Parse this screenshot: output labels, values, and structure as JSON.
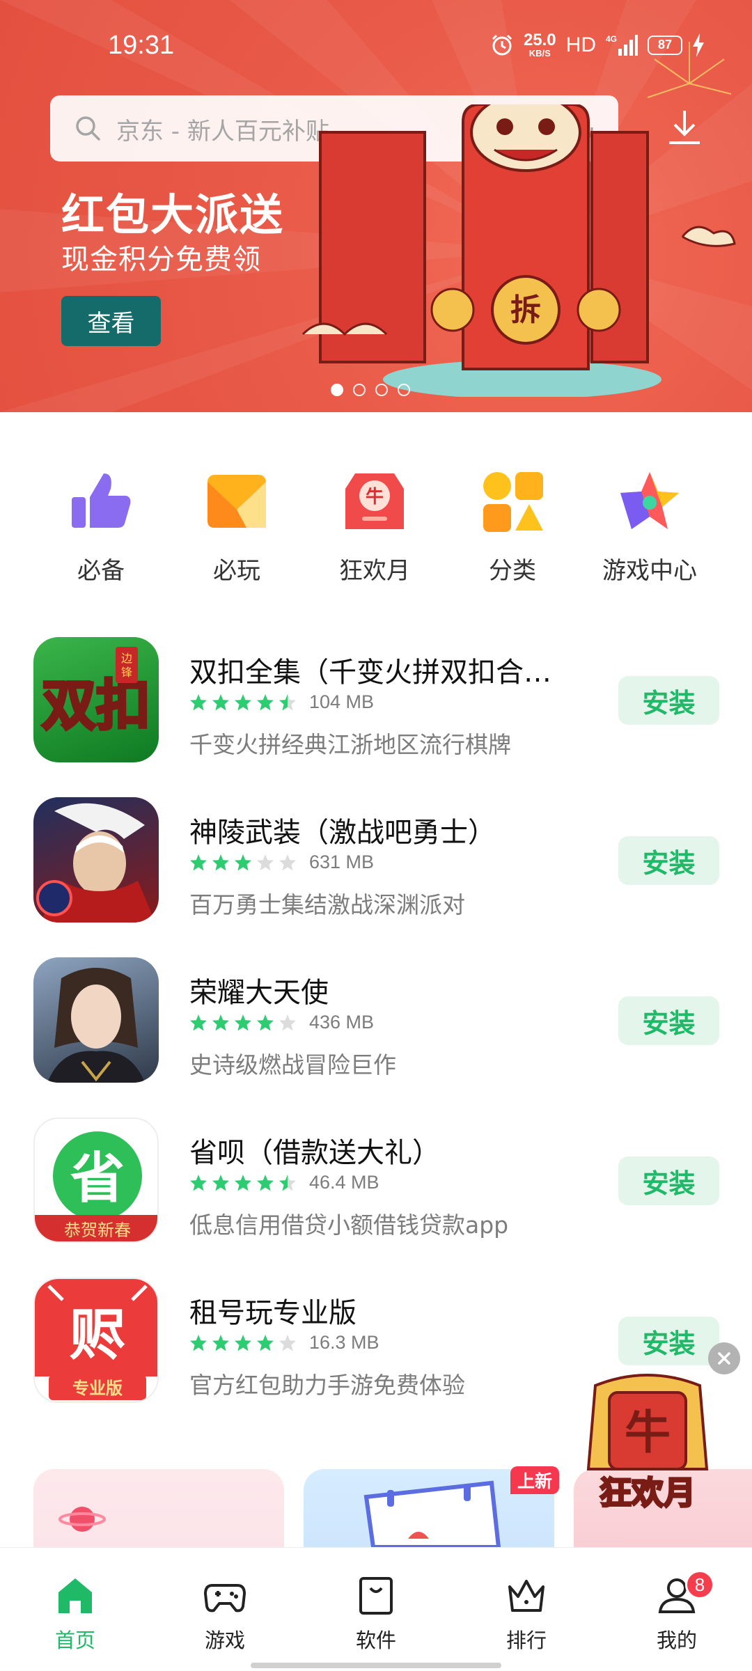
{
  "status": {
    "time": "19:31",
    "net_speed": "25.0",
    "net_unit": "KB/S",
    "hd": "HD",
    "network": "4G",
    "battery": "87"
  },
  "search": {
    "placeholder": "京东 - 新人百元补贴"
  },
  "banner": {
    "title": "红包大派送",
    "subtitle": "现金积分免费领",
    "button": "查看",
    "envelope_char": "拆",
    "dots_count": 4,
    "active_dot": 0
  },
  "categories": [
    {
      "label": "必备",
      "icon": "thumbs-up-icon",
      "color": "#8a6cf0"
    },
    {
      "label": "必玩",
      "icon": "fold-icon",
      "color": "#ffb21c"
    },
    {
      "label": "狂欢月",
      "icon": "red-envelope-icon",
      "color": "#f04a4a"
    },
    {
      "label": "分类",
      "icon": "category-icon",
      "color": "#ffb21c"
    },
    {
      "label": "游戏中心",
      "icon": "star-icon",
      "color": "#ff5a5a"
    }
  ],
  "apps": [
    {
      "name": "双扣全集（千变火拼双扣合…",
      "rating": 4.5,
      "size": "104 MB",
      "desc": "千变火拼经典江浙地区流行棋牌",
      "install": "安装",
      "icon_text": "双扣",
      "icon_tag": "边锋"
    },
    {
      "name": "神陵武装（激战吧勇士）",
      "rating": 3,
      "size": "631 MB",
      "desc": "百万勇士集结激战深渊派对",
      "install": "安装"
    },
    {
      "name": "荣耀大天使",
      "rating": 4,
      "size": "436 MB",
      "desc": "史诗级燃战冒险巨作",
      "install": "安装"
    },
    {
      "name": "省呗（借款送大礼）",
      "rating": 4.5,
      "size": "46.4 MB",
      "desc": "低息信用借贷小额借钱贷款app",
      "install": "安装",
      "icon_text": "省",
      "icon_banner": "恭贺新春"
    },
    {
      "name": "租号玩专业版",
      "rating": 4,
      "size": "16.3 MB",
      "desc": "官方红包助力手游免费体验",
      "install": "安装",
      "icon_text": "赆",
      "icon_banner": "专业版"
    }
  ],
  "cards": {
    "new_badge": "上新",
    "float_text": "狂欢月",
    "float_char": "牛"
  },
  "nav": [
    {
      "label": "首页",
      "icon": "home-icon",
      "active": true
    },
    {
      "label": "游戏",
      "icon": "gamepad-icon",
      "active": false
    },
    {
      "label": "软件",
      "icon": "bag-icon",
      "active": false
    },
    {
      "label": "排行",
      "icon": "crown-icon",
      "active": false
    },
    {
      "label": "我的",
      "icon": "user-icon",
      "active": false,
      "badge": "8"
    }
  ],
  "colors": {
    "banner": "#e95a48",
    "accent": "#1fb968",
    "install_bg": "#e4f5ec",
    "star": "#2ecc71"
  }
}
